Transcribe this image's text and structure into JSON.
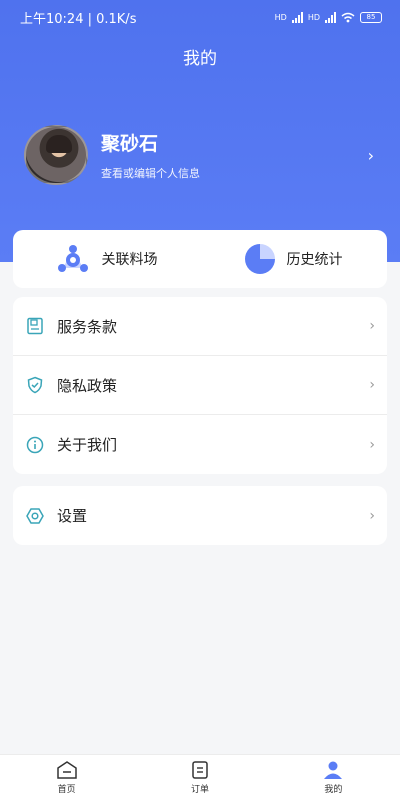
{
  "status_bar": {
    "time_speed": "上午10:24 | 0.1K/s",
    "hd1": "HD",
    "hd2": "HD",
    "battery": "85"
  },
  "header": {
    "title": "我的"
  },
  "profile": {
    "name": "聚砂石",
    "subtitle": "查看或编辑个人信息"
  },
  "quick_actions": [
    {
      "label": "关联料场",
      "icon": "linked-yard-icon"
    },
    {
      "label": "历史统计",
      "icon": "pie-chart-icon"
    }
  ],
  "menu_main": [
    {
      "label": "服务条款",
      "icon": "document-icon"
    },
    {
      "label": "隐私政策",
      "icon": "shield-check-icon"
    },
    {
      "label": "关于我们",
      "icon": "info-icon"
    }
  ],
  "menu_settings": [
    {
      "label": "设置",
      "icon": "hexagon-settings-icon"
    }
  ],
  "tabbar": [
    {
      "label": "首页",
      "icon": "home-icon"
    },
    {
      "label": "订单",
      "icon": "order-icon"
    },
    {
      "label": "我的",
      "icon": "user-icon"
    }
  ],
  "colors": {
    "brand": "#5b7df5",
    "teal_icon": "#3aa5b8"
  }
}
